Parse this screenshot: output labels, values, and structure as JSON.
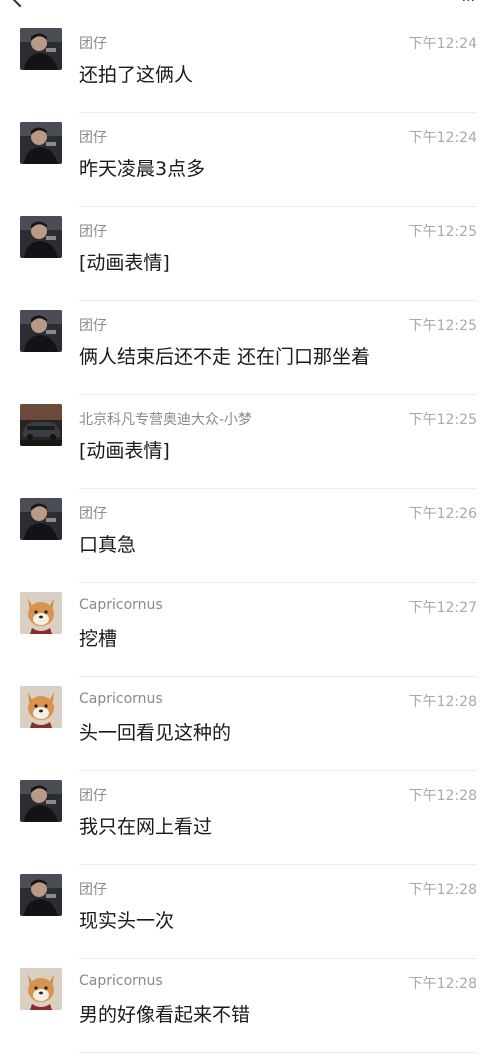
{
  "messages": [
    {
      "avatar": "man-avatar",
      "name": "团仔",
      "time": "下午12:24",
      "text": "还拍了这俩人"
    },
    {
      "avatar": "man-avatar",
      "name": "团仔",
      "time": "下午12:24",
      "text": "昨天凌晨3点多"
    },
    {
      "avatar": "man-avatar",
      "name": "团仔",
      "time": "下午12:25",
      "text": "[动画表情]"
    },
    {
      "avatar": "man-avatar",
      "name": "团仔",
      "time": "下午12:25",
      "text": "俩人结束后还不走 还在门口那坐着"
    },
    {
      "avatar": "car-avatar",
      "name": "北京科凡专营奥迪大众-小梦",
      "time": "下午12:25",
      "text": "[动画表情]"
    },
    {
      "avatar": "man-avatar",
      "name": "团仔",
      "time": "下午12:26",
      "text": "口真急"
    },
    {
      "avatar": "dog-avatar",
      "name": "Capricornus",
      "time": "下午12:27",
      "text": "挖槽"
    },
    {
      "avatar": "dog-avatar",
      "name": "Capricornus",
      "time": "下午12:28",
      "text": "头一回看见这种的"
    },
    {
      "avatar": "man-avatar",
      "name": "团仔",
      "time": "下午12:28",
      "text": "我只在网上看过"
    },
    {
      "avatar": "man-avatar",
      "name": "团仔",
      "time": "下午12:28",
      "text": "现实头一次"
    },
    {
      "avatar": "dog-avatar",
      "name": "Capricornus",
      "time": "下午12:28",
      "text": "男的好像看起来不错"
    }
  ]
}
